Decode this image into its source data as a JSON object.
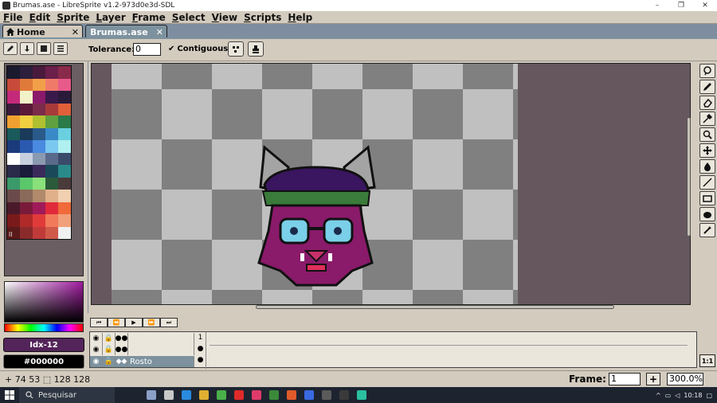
{
  "window": {
    "title": "Brumas.ase - LibreSprite v1.2-973d0e3d-SDL",
    "minimize": "–",
    "maximize": "❐",
    "close": "✕"
  },
  "menu": [
    "File",
    "Edit",
    "Sprite",
    "Layer",
    "Frame",
    "Select",
    "View",
    "Scripts",
    "Help"
  ],
  "tabs": {
    "home": "Home",
    "document": "Brumas.ase",
    "close": "✕"
  },
  "toolbar": {
    "tolerance_label": "Tolerance:",
    "tolerance_value": "0",
    "contiguous_label": "Contiguous",
    "contiguous_check": "✔"
  },
  "palette": {
    "colors": [
      "#1a1a2e",
      "#2b1f3d",
      "#4a1a3c",
      "#6b1f4a",
      "#8a2a4a",
      "#c74a3a",
      "#e07a3a",
      "#f2a048",
      "#f07a6a",
      "#e85a8a",
      "#c42a7a",
      "#f2f2c8",
      "#8a1a6a",
      "#3a1a4a",
      "#2a1a3a",
      "#3a1a3a",
      "#5a1a3a",
      "#7a2a4a",
      "#a83a3a",
      "#e0603a",
      "#f0a030",
      "#f0d040",
      "#b0c030",
      "#60a040",
      "#2a7a4a",
      "#1a5a5a",
      "#1a3a5a",
      "#2a5a8a",
      "#3a8ac8",
      "#6ad0e0",
      "#1a3a7a",
      "#2a5ab0",
      "#4a8ae0",
      "#7ac8f0",
      "#b0f0f0",
      "#ffffff",
      "#c8d0e0",
      "#8a9ab0",
      "#5a6a8a",
      "#3a4a6a",
      "#2a2a4a",
      "#1a1a3a",
      "#3a2a5a",
      "#1a4a5a",
      "#2a8a8a",
      "#3a9a6a",
      "#5ac86a",
      "#8ae07a",
      "#2a5a3a",
      "#4a3a3a",
      "#6a4a4a",
      "#8a6a5a",
      "#b08a6a",
      "#e0b08a",
      "#f0d0b0",
      "#4a1a2a",
      "#7a1a3a",
      "#a01a5a",
      "#e02a3a",
      "#f06a3a",
      "#7a1a1a",
      "#b02a2a",
      "#e03a3a",
      "#f07a5a",
      "#f0a07a",
      "#5a1a1a",
      "#8a2a2a",
      "#c03a3a",
      "#d05a4a",
      "#f0f0f0"
    ],
    "mark": "ll"
  },
  "colors": {
    "foreground_label": "Idx-12",
    "foreground_color": "#53245a",
    "background_label": "#000000",
    "background_color": "#000000"
  },
  "timeline": {
    "buttons": [
      "⏮",
      "⏪",
      "▶",
      "⏩",
      "⏭"
    ],
    "layers": [
      {
        "name": "",
        "eye": "◉",
        "lock": "🔒",
        "cont": "●●"
      },
      {
        "name": "",
        "eye": "◉",
        "lock": "🔒",
        "cont": "●●"
      },
      {
        "name": "Rosto",
        "eye": "◉",
        "lock": "🔒",
        "cont": "◆◆"
      }
    ],
    "frame_number": "1"
  },
  "status": {
    "coords": "74 53",
    "size": "128 128",
    "frame_label": "Frame:",
    "frame_value": "1",
    "add_frame": "+",
    "zoom": "300.0%",
    "one_to_one": "1:1"
  },
  "taskbar": {
    "search": "Pesquisar",
    "time": "10:18"
  }
}
